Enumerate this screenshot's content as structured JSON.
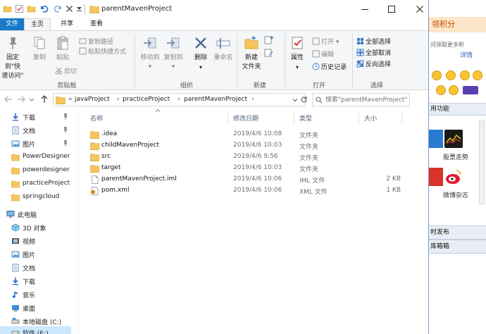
{
  "window": {
    "title": "parentMavenProject"
  },
  "ribbon": {
    "tabs": [
      {
        "label": "文件"
      },
      {
        "label": "主页"
      },
      {
        "label": "共享"
      },
      {
        "label": "查看"
      }
    ],
    "clipboard": {
      "pin_label_1": "固定到\"快",
      "pin_label_2": "速访问\"",
      "copy": "复制",
      "paste": "粘贴",
      "copy_path": "复制路径",
      "paste_shortcut": "粘贴快捷方式",
      "cut": "剪切",
      "group": "剪贴板"
    },
    "organize": {
      "move_to": "移动到",
      "copy_to": "复制到",
      "delete": "删除",
      "rename": "重命名",
      "group": "组织"
    },
    "new": {
      "new_folder_1": "新建",
      "new_folder_2": "文件夹",
      "group": "新建"
    },
    "open": {
      "properties": "属性",
      "open": "打开",
      "edit": "编辑",
      "history": "历史记录",
      "group": "打开"
    },
    "select": {
      "select_all": "全部选择",
      "select_none": "全部取消",
      "invert": "反向选择",
      "group": "选择"
    }
  },
  "address": {
    "prefix": "«",
    "crumbs": [
      "javaProject",
      "practiceProject",
      "parentMavenProject"
    ],
    "search_placeholder": "搜索\"parentMavenProject\""
  },
  "navpane": {
    "quick": [
      {
        "label": "下载",
        "icon": "download-arrow-icon",
        "pinned": true
      },
      {
        "label": "文档",
        "icon": "document-icon",
        "pinned": true
      },
      {
        "label": "图片",
        "icon": "picture-icon",
        "pinned": true
      },
      {
        "label": "PowerDesigner",
        "icon": "folder-icon",
        "pinned": false
      },
      {
        "label": "powerdesigner",
        "icon": "folder-icon",
        "pinned": false
      },
      {
        "label": "practiceProject",
        "icon": "folder-icon",
        "pinned": false
      },
      {
        "label": "springcloud",
        "icon": "folder-icon",
        "pinned": false
      }
    ],
    "this_pc": "此电脑",
    "pc_items": [
      {
        "label": "3D 对象",
        "icon": "cube-icon"
      },
      {
        "label": "视频",
        "icon": "video-icon"
      },
      {
        "label": "图片",
        "icon": "picture-icon"
      },
      {
        "label": "文档",
        "icon": "document-icon"
      },
      {
        "label": "下载",
        "icon": "download-arrow-icon"
      },
      {
        "label": "音乐",
        "icon": "music-note-icon"
      },
      {
        "label": "桌面",
        "icon": "desktop-icon"
      },
      {
        "label": "本地磁盘 (C:)",
        "icon": "drive-icon"
      },
      {
        "label": "软件 (E:)",
        "icon": "drive-icon"
      }
    ]
  },
  "filelist": {
    "columns": {
      "name": "名称",
      "date": "修改日期",
      "type": "类型",
      "size": "大小"
    },
    "rows": [
      {
        "name": ".idea",
        "date": "2019/4/6 10:08",
        "type": "文件夹",
        "size": "",
        "icon": "folder-icon"
      },
      {
        "name": "childMavenProject",
        "date": "2019/4/6 10:03",
        "type": "文件夹",
        "size": "",
        "icon": "folder-icon"
      },
      {
        "name": "src",
        "date": "2019/4/6 9:56",
        "type": "文件夹",
        "size": "",
        "icon": "folder-icon"
      },
      {
        "name": "target",
        "date": "2019/4/6 10:03",
        "type": "文件夹",
        "size": "",
        "icon": "folder-icon"
      },
      {
        "name": "parentMavenProject.iml",
        "date": "2019/4/6 10:06",
        "type": "IML 文件",
        "size": "2 KB",
        "icon": "file-icon"
      },
      {
        "name": "pom.xml",
        "date": "2019/4/6 10:06",
        "type": "XML 文件",
        "size": "1 KB",
        "icon": "xml-file-icon"
      }
    ]
  },
  "background": {
    "points": "领积分",
    "link": "问领取更多积",
    "detail": "详情",
    "func": "用功能",
    "label1": "股票走势",
    "label2": "微博杂志",
    "bar1": "时发布",
    "bar2": "库箱箱"
  }
}
